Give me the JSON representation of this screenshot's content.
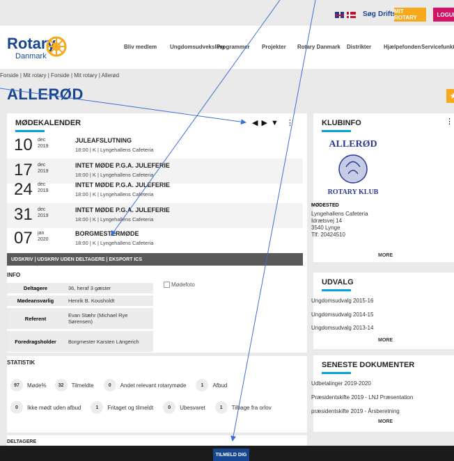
{
  "topbar": {
    "flags": [
      "uk-flag-icon",
      "dk-flag-icon"
    ],
    "search_label": "Søg",
    "status_label": "Driftsstatus",
    "mit_rotary_label": "MIT ROTARY",
    "logud_label": "LOGUD"
  },
  "brand": {
    "name": "Rotary",
    "sub": "Danmark"
  },
  "nav": [
    "Bliv medlem",
    "Ungdomsudveksling",
    "Programmer",
    "Projekter",
    "Rotary Danmark",
    "Distrikter",
    "Hjælpefonden",
    "Servicefunktion"
  ],
  "breadcrumb": "Forside | Mit rotary | Forside | Mit rotary | Allerød",
  "page_title": "ALLERØD",
  "calendar": {
    "heading": "MØDEKALENDER",
    "events": [
      {
        "day": "10",
        "month": "dec",
        "year": "2019",
        "title": "JULEAFSLUTNING",
        "sub": "18:00 | K | Lyngehallens Cafeteria"
      },
      {
        "day": "17",
        "month": "dec",
        "year": "2019",
        "title": "INTET MØDE P.G.A. JULEFERIE",
        "sub": "18:00 | K | Lyngehallens Cafeteria"
      },
      {
        "day": "24",
        "month": "dec",
        "year": "2019",
        "title": "INTET MØDE P.G.A. JULEFERIE",
        "sub": "18:00 | K | Lyngehallens Cafeteria"
      },
      {
        "day": "31",
        "month": "dec",
        "year": "2019",
        "title": "INTET MØDE P.G.A. JULEFERIE",
        "sub": "18:00 | K | Lyngehallens Cafeteria"
      },
      {
        "day": "07",
        "month": "jan",
        "year": "2020",
        "title": "BORGMESTERMØDE",
        "sub": "18:00 | K | Lyngehallens Cafeteria"
      }
    ],
    "export_bar": "UDSKRIV  |  UDSKRIV UDEN DELTAGERE  |  EKSPORT ICS"
  },
  "info": {
    "heading": "INFO",
    "rows": [
      {
        "label": "Deltagere",
        "value": "36, heraf 3 gæster"
      },
      {
        "label": "Mødeansvarlig",
        "value": "Henrik B. Kousholdt"
      },
      {
        "label": "Referent",
        "value": "Evan Stæhr (Michael Rye Sørensen)"
      },
      {
        "label": "Foredragsholder",
        "value": "Borgmester Karsten Längerich"
      }
    ],
    "photo_alt": "Mødefoto"
  },
  "stats": {
    "heading": "STATISTIK",
    "row1": [
      {
        "n": "97",
        "label": "Møde%"
      },
      {
        "n": "32",
        "label": "Tilmeldte"
      },
      {
        "n": "0",
        "label": "Andet relevant rotarymøde"
      },
      {
        "n": "1",
        "label": "Afbud"
      }
    ],
    "row2": [
      {
        "n": "0",
        "label": "Ikke mødt uden afbud"
      },
      {
        "n": "1",
        "label": "Fritaget og tilmeldt"
      },
      {
        "n": "0",
        "label": "Ubesvaret"
      },
      {
        "n": "1",
        "label": "Tilbage fra orlov"
      }
    ]
  },
  "deltagere_heading": "DELTAGERE",
  "klubinfo": {
    "heading": "KLUBINFO",
    "logo_text_top": "ALLERØD",
    "logo_text_bottom": "ROTARY KLUB",
    "modested_label": "MØDESTED",
    "address": [
      "Lyngehallens Cafeteria",
      "Idrætsvej 14",
      "3540 Lynge",
      "Tlf: 20424510"
    ],
    "more": "MORE"
  },
  "udvalg": {
    "heading": "UDVALG",
    "items": [
      "Ungdomsudvalg 2015-16",
      "Ungdomsudvalg 2014-15",
      "Ungdomsudvalg 2013-14"
    ],
    "more": "MORE"
  },
  "dokumenter": {
    "heading": "SENESTE DOKUMENTER",
    "items": [
      "Udbetalinger 2019-2020",
      "Præsidentskifte 2019 - LNJ Præsentation",
      "præsidentskifte 2019 - Årsberetning"
    ],
    "more": "MORE"
  },
  "tilmeld_label": "TILMELD DIG",
  "colors": {
    "brand": "#17458f",
    "gold": "#f7a81b",
    "accent": "#00a2e0",
    "logud": "#d41367"
  }
}
